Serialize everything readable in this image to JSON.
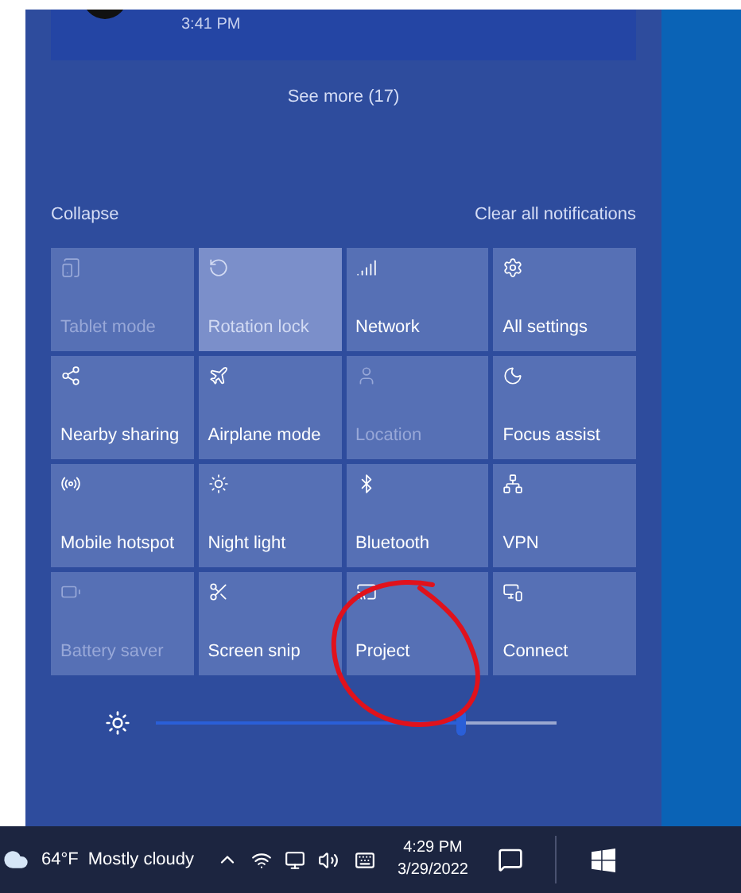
{
  "notification": {
    "time": "3:41 PM"
  },
  "see_more": "See more (17)",
  "collapse": "Collapse",
  "clear_all": "Clear all notifications",
  "tiles": [
    {
      "label": "Tablet mode",
      "on": false,
      "disabled": true
    },
    {
      "label": "Rotation lock",
      "on": true,
      "disabled": true
    },
    {
      "label": "Network",
      "on": false,
      "disabled": false
    },
    {
      "label": "All settings",
      "on": false,
      "disabled": false
    },
    {
      "label": "Nearby sharing",
      "on": false,
      "disabled": false
    },
    {
      "label": "Airplane mode",
      "on": false,
      "disabled": false
    },
    {
      "label": "Location",
      "on": false,
      "disabled": true
    },
    {
      "label": "Focus assist",
      "on": false,
      "disabled": false
    },
    {
      "label": "Mobile hotspot",
      "on": false,
      "disabled": false
    },
    {
      "label": "Night light",
      "on": false,
      "disabled": false
    },
    {
      "label": "Bluetooth",
      "on": false,
      "disabled": false
    },
    {
      "label": "VPN",
      "on": false,
      "disabled": false
    },
    {
      "label": "Battery saver",
      "on": false,
      "disabled": true
    },
    {
      "label": "Screen snip",
      "on": false,
      "disabled": false
    },
    {
      "label": "Project",
      "on": false,
      "disabled": false
    },
    {
      "label": "Connect",
      "on": false,
      "disabled": false
    }
  ],
  "brightness": {
    "level": 0.76
  },
  "taskbar": {
    "temperature": "64°F",
    "weather": "Mostly cloudy",
    "time": "4:29 PM",
    "date": "3/29/2022"
  }
}
